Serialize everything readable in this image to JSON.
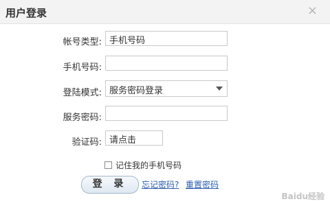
{
  "dialog": {
    "title": "用户登录",
    "close_icon": "close-icon",
    "close_glyph": "×"
  },
  "form": {
    "account_type": {
      "label": "帐号类型:",
      "value": "手机号码"
    },
    "phone": {
      "label": "手机号码:",
      "value": ""
    },
    "login_mode": {
      "label": "登陆模式:",
      "value": "服务密码登录"
    },
    "service_password": {
      "label": "服务密码:",
      "value": ""
    },
    "captcha": {
      "label": "验证码:",
      "value": "请点击"
    },
    "remember_label": "记住我的手机号码"
  },
  "actions": {
    "login_label": "登 录",
    "forgot_password": "忘记密码?",
    "reset_password": "重置密码"
  },
  "watermark": "Baidu经验"
}
